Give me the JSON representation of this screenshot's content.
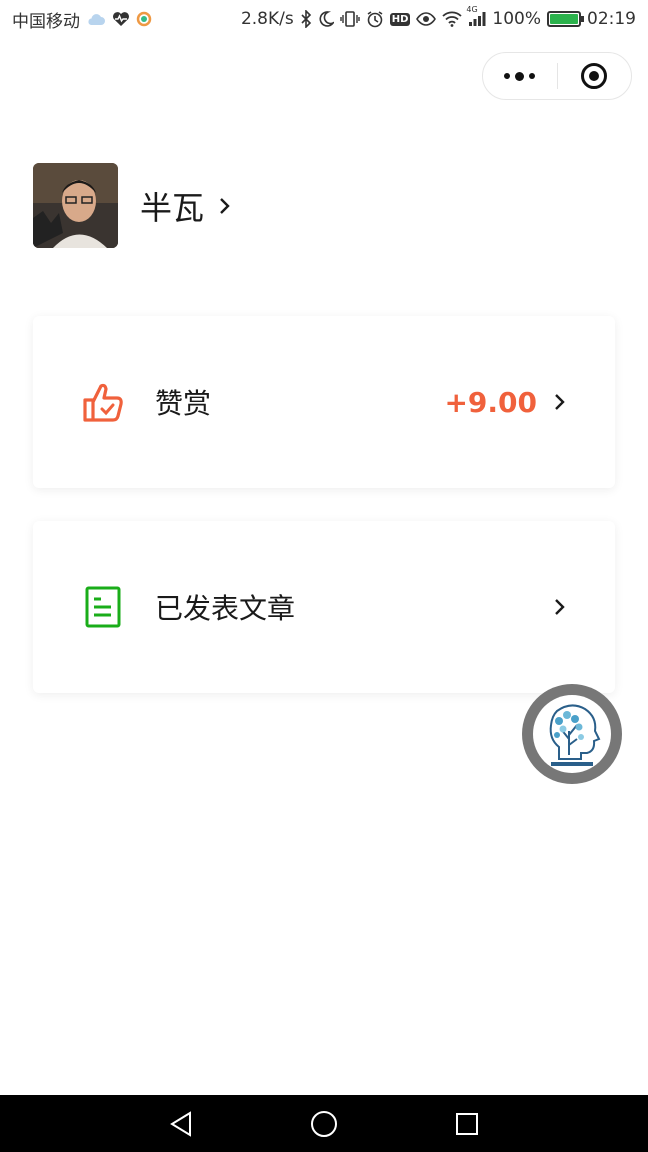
{
  "status_bar": {
    "carrier": "中国移动",
    "network_speed": "2.8K/s",
    "battery_percent": "100%",
    "time": "02:19",
    "network_type": "4G",
    "hd_badge": "HD",
    "battery_level": 1.0
  },
  "profile": {
    "name": "半瓦"
  },
  "cards": {
    "praise": {
      "label": "赞赏",
      "value": "+9.00"
    },
    "articles": {
      "label": "已发表文章"
    }
  },
  "colors": {
    "accent_orange": "#f0613c",
    "accent_green": "#1aad19",
    "navbar": "#000000"
  },
  "icons": {
    "praise": "thumbs-up-check-icon",
    "articles": "document-icon",
    "floating": "brain-tree-logo",
    "menu": "more-dots-icon",
    "close": "target-circle-icon"
  }
}
